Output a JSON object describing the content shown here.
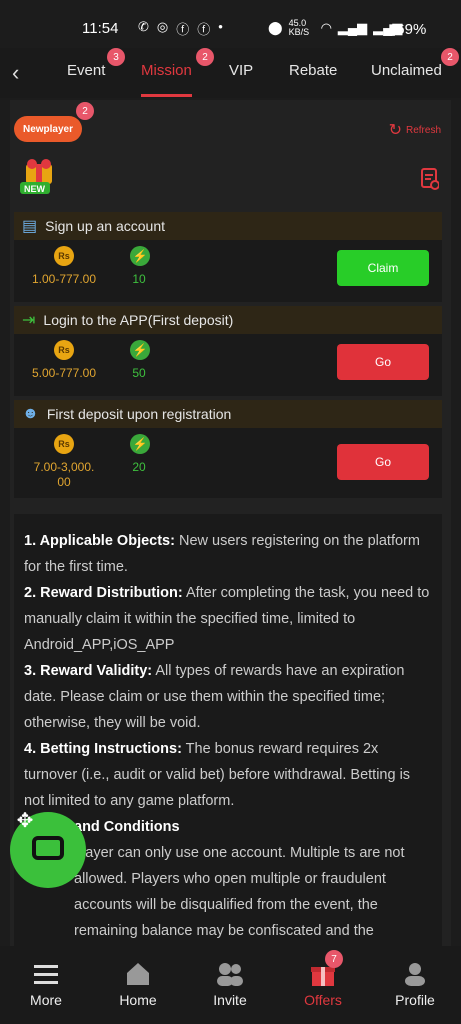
{
  "status_bar": {
    "time": "11:54",
    "network_speed": "45.0 KB/S",
    "battery": "69%"
  },
  "tabs": [
    {
      "label": "Event",
      "badge": "3"
    },
    {
      "label": "Mission",
      "badge": "2",
      "active": true
    },
    {
      "label": "VIP"
    },
    {
      "label": "Rebate"
    },
    {
      "label": "Unclaimed",
      "badge": "2"
    }
  ],
  "newplayer": {
    "label": "Newplayer",
    "badge": "2"
  },
  "refresh_label": "Refresh",
  "gift_badge": "NEW",
  "tasks": [
    {
      "title": "Sign up an account",
      "currency": "Rs",
      "amount": "1.00-777.00",
      "points": "10",
      "button": "Claim",
      "button_color": "#28cd28"
    },
    {
      "title": "Login to the APP(First deposit)",
      "currency": "Rs",
      "amount": "5.00-777.00",
      "points": "50",
      "button": "Go",
      "button_color": "#e0323a"
    },
    {
      "title": "First deposit upon registration",
      "currency": "Rs",
      "amount": "7.00-3,000.\n00",
      "points": "20",
      "button": "Go",
      "button_color": "#e0323a"
    }
  ],
  "rules": [
    {
      "heading": "1. Applicable Objects:",
      "text": " New users registering on the platform for the first time."
    },
    {
      "heading": "2. Reward Distribution:",
      "text": " After completing the task, you need to manually claim it within the specified time, limited to Android_APP,iOS_APP"
    },
    {
      "heading": "3. Reward Validity:",
      "text": " All types of rewards have an expiration date. Please claim or use them within the specified time; otherwise, they will be void."
    },
    {
      "heading": "4. Betting Instructions:",
      "text": " The bonus reward requires 2x turnover (i.e., audit or valid bet) before withdrawal. Betting is not limited to any game platform."
    },
    {
      "heading": "and Conditions",
      "text": ""
    },
    {
      "heading": "",
      "text": "player can only use one account. Multiple ts are not allowed. Players who open multiple or fraudulent accounts will be disqualified from the event, the remaining balance may be confiscated and the"
    }
  ],
  "bottom_nav": [
    {
      "label": "More"
    },
    {
      "label": "Home"
    },
    {
      "label": "Invite"
    },
    {
      "label": "Offers",
      "badge": "7",
      "active": true
    },
    {
      "label": "Profile"
    }
  ],
  "colors": {
    "accent": "#e0383f",
    "claim": "#28cd28",
    "go": "#e0323a",
    "amount": "#e0a530",
    "points": "#3ec03e"
  }
}
